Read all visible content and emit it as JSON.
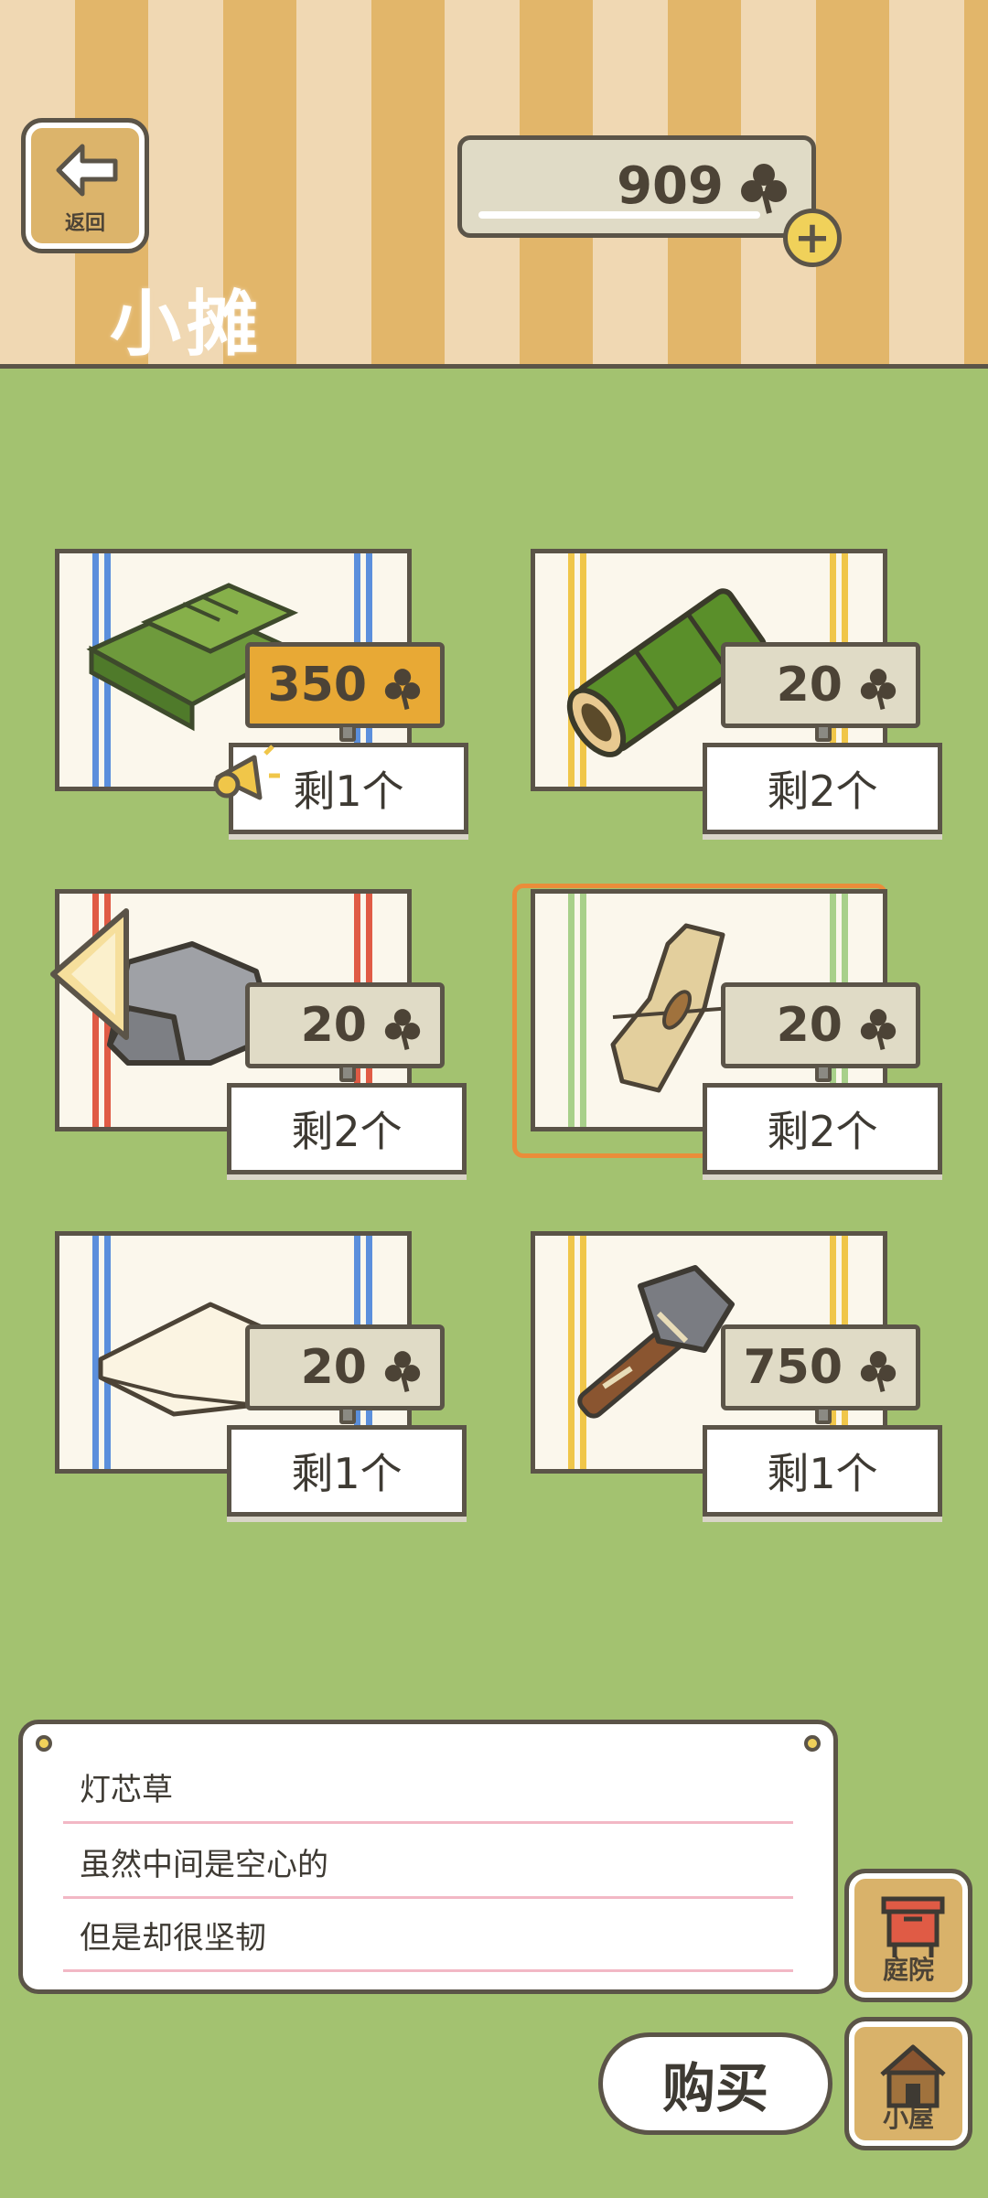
{
  "header": {
    "back_label": "返回",
    "title": "小摊",
    "clovers": "909"
  },
  "colors": {
    "grass": "#a3c270",
    "gold_tag": "#e8a935",
    "tag": "#e0dbc6",
    "selected_outline": "#ea8d3a"
  },
  "items": [
    {
      "name": "maze-board",
      "price": "350",
      "stock": "剩1个",
      "stripe": "#5b8fdc",
      "highlight": true
    },
    {
      "name": "bamboo",
      "price": "20",
      "stock": "剩2个",
      "stripe": "#f0c649"
    },
    {
      "name": "rock",
      "price": "20",
      "stock": "剩2个",
      "stripe": "#e05b45"
    },
    {
      "name": "rush-bundle",
      "price": "20",
      "stock": "剩2个",
      "stripe": "#a8d08a",
      "selected": true
    },
    {
      "name": "cloth",
      "price": "20",
      "stock": "剩1个",
      "stripe": "#5b8fdc"
    },
    {
      "name": "stone-axe",
      "price": "750",
      "stock": "剩1个",
      "stripe": "#f0c649"
    }
  ],
  "description": {
    "title": "灯芯草",
    "line1": "虽然中间是空心的",
    "line2": "但是却很坚韧"
  },
  "buttons": {
    "yard": "庭院",
    "house": "小屋",
    "buy": "购买"
  }
}
